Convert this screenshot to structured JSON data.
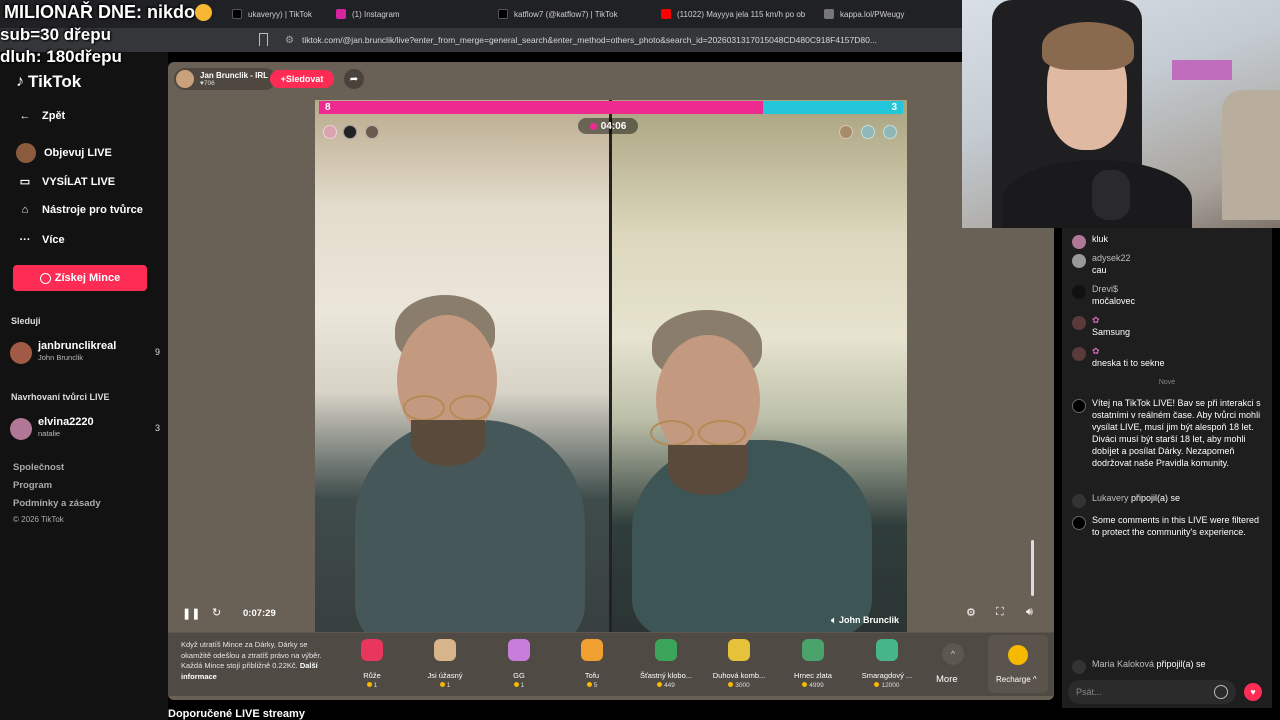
{
  "overlay": {
    "line1": "MILIONAŘ DNE: nikdo",
    "line2": "sub=30 dřepu",
    "line3": "dluh: 180dřepu"
  },
  "browser": {
    "tabs": [
      {
        "label": "ukaveryy) | TikTok",
        "color": "#000000"
      },
      {
        "label": "(1) Instagram",
        "color": "#d6249f"
      },
      {
        "label": "katflow7 (@katflow7) | TikTok",
        "color": "#000000"
      },
      {
        "label": "(11022) Mayyya jela 115 km/h po ob",
        "color": "#ff0000"
      },
      {
        "label": "kappa.lol/PWeugy",
        "color": "#777777"
      }
    ],
    "url": "tiktok.com/@jan.brunclik/live?enter_from_merge=general_search&enter_method=others_photo&search_id=2026031317015048CD480C918F4157D80..."
  },
  "sidebar": {
    "logo": "TikTok",
    "back": "Zpět",
    "items": [
      {
        "label": "Objevuj LIVE",
        "icon": "avatar-icon"
      },
      {
        "label": "VYSÍLAT LIVE",
        "icon": "video-camera-icon"
      },
      {
        "label": "Nástroje pro tvůrce",
        "icon": "home-icon"
      },
      {
        "label": "Více",
        "icon": "ellipsis-icon"
      }
    ],
    "coins_button": "Získej Mince",
    "following_title": "Sleduji",
    "following": [
      {
        "name": "janbrunclikreal",
        "sub": "John Brunclik",
        "count": "9"
      }
    ],
    "suggested_title": "Navrhovaní tvůrci LIVE",
    "suggested": [
      {
        "name": "elvina2220",
        "sub": "natalie",
        "count": "3"
      }
    ],
    "footer": [
      "Společnost",
      "Program",
      "Podmínky a zásady"
    ],
    "copyright": "© 2026 TikTok"
  },
  "stage": {
    "host_name": "Jan Brunclik - IRL",
    "host_likes": "706",
    "follow_label": "Sledovat",
    "score_left": "8",
    "score_right": "3",
    "timer": "04:06",
    "bottom_name": "John Brunclik",
    "elapsed": "0:07:29",
    "vote_share_left": 0.76
  },
  "gifts": {
    "info": "Když utratíš Mince za Dárky, Dárky se okamžitě odešlou a ztratíš právo na výběr. Každá Mince stojí přibližně 0.22Kč.",
    "info_link": "Další informace",
    "items": [
      {
        "name": "Růže",
        "price": "1",
        "color": "#e8365d"
      },
      {
        "name": "Jsi úžasný",
        "price": "1",
        "color": "#d8b48a"
      },
      {
        "name": "GG",
        "price": "1",
        "color": "#c77dd9"
      },
      {
        "name": "Tofu",
        "price": "5",
        "color": "#f0a030"
      },
      {
        "name": "Šťastný klobo...",
        "price": "449",
        "color": "#3ba65b"
      },
      {
        "name": "Duhová komb...",
        "price": "3000",
        "color": "#e6c13a"
      },
      {
        "name": "Hrnec zlata",
        "price": "4999",
        "color": "#4aa36a"
      },
      {
        "name": "Smaragdový ...",
        "price": "12000",
        "color": "#47b58a"
      }
    ],
    "more": "More",
    "recharge": "Recharge"
  },
  "below_title": "Doporučené LIVE streamy",
  "chat": {
    "messages": [
      {
        "user": "",
        "text": "kluk"
      },
      {
        "user": "adysek22",
        "text": "cau"
      },
      {
        "user": "Drevi$",
        "text": "močalovec"
      },
      {
        "user": "",
        "text": "Samsung"
      },
      {
        "user": "",
        "text": "dneska ti to sekne"
      }
    ],
    "new_label": "Nové",
    "welcome": "Vítej na TikTok LIVE! Bav se při interakci s ostatními v reálném čase. Aby tvůrci mohli vysílat LIVE, musí jim být alespoň 18 let. Diváci musí být starší 18 let, aby mohli dobíjet a posílat Dárky. Nezapomeň dodržovat naše Pravidla komunity.",
    "join1_user": "Lukavery",
    "join_text": "připojil(a) se",
    "filtered": "Some comments in this LIVE were filtered to protect the community's experience.",
    "join2_user": "Maria Kaloková",
    "input_placeholder": "Psát..."
  }
}
